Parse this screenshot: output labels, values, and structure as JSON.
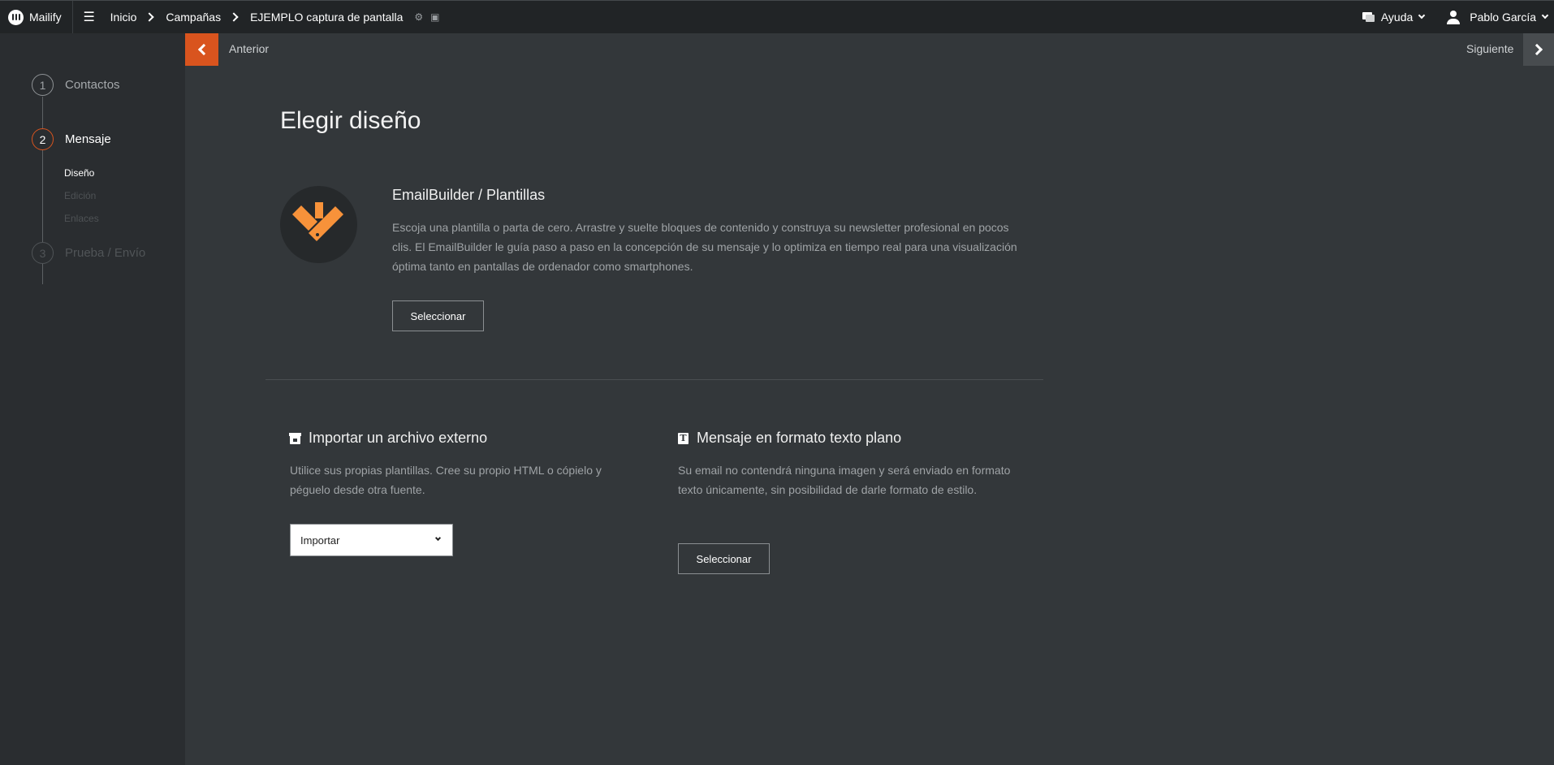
{
  "topbar": {
    "logo_text": "Mailify",
    "breadcrumbs": [
      "Inicio",
      "Campañas",
      "EJEMPLO captura de pantalla"
    ],
    "help_label": "Ayuda",
    "user_name": "Pablo García"
  },
  "nav": {
    "prev_label": "Anterior",
    "next_label": "Siguiente"
  },
  "steps": [
    {
      "num": "1",
      "label": "Contactos",
      "state": "done"
    },
    {
      "num": "2",
      "label": "Mensaje",
      "state": "active"
    },
    {
      "num": "3",
      "label": "Prueba / Envío",
      "state": "disabled"
    }
  ],
  "substeps": [
    "Diseño",
    "Edición",
    "Enlaces"
  ],
  "main": {
    "title": "Elegir diseño",
    "emailbuilder": {
      "title": "EmailBuilder / Plantillas",
      "description": "Escoja una plantilla o parta de cero. Arrastre y suelte bloques de contenido y construya su newsletter profesional en pocos clis. El EmailBuilder le guía paso a paso en la concepción de su mensaje y lo optimiza en tiempo real para una visualización óptima tanto en pantallas de ordenador como smartphones.",
      "button": "Seleccionar"
    },
    "import": {
      "title": "Importar un archivo externo",
      "description": "Utilice sus propias plantillas. Cree su propio HTML o cópielo y péguelo desde otra fuente.",
      "select_value": "Importar"
    },
    "plaintext": {
      "title": "Mensaje en formato texto plano",
      "description": "Su email no contendrá ninguna imagen y será enviado en formato texto únicamente, sin posibilidad de darle formato de estilo.",
      "button": "Seleccionar",
      "icon_glyph": "T"
    }
  },
  "colors": {
    "accent": "#d9541e",
    "logo_orange": "#f7923a",
    "background": "#33373a",
    "sidebar": "#2a2d30",
    "topbar": "#212426"
  }
}
